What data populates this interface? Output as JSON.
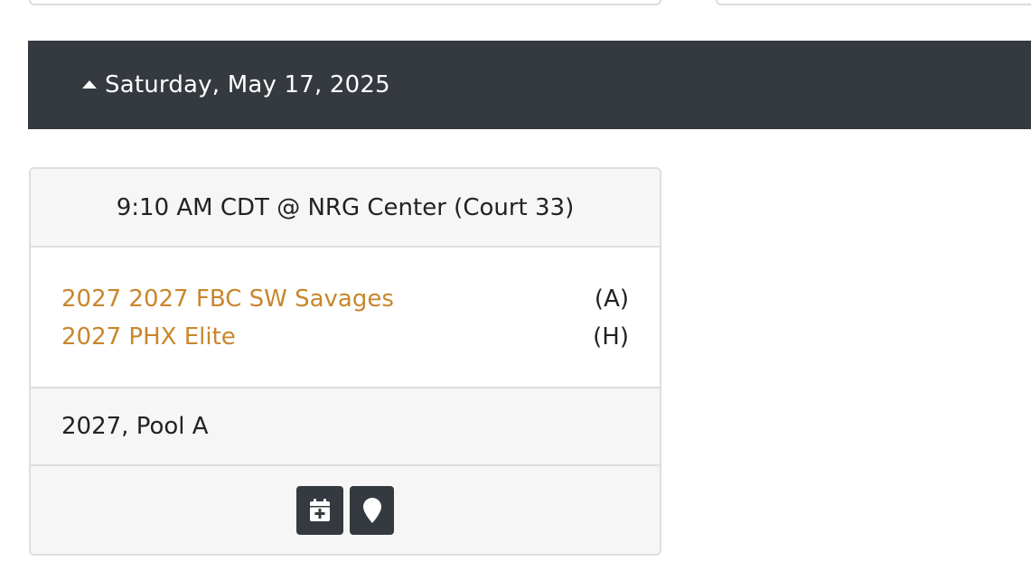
{
  "day_section": {
    "title": "Saturday, May 17, 2025"
  },
  "game": {
    "header": "9:10 AM CDT @ NRG Center (Court 33)",
    "teams": [
      {
        "name": "2027 2027 FBC SW Savages",
        "role": "(A)"
      },
      {
        "name": "2027 PHX Elite",
        "role": "(H)"
      }
    ],
    "pool": "2027, Pool A",
    "actions": [
      {
        "icon": "calendar-plus-icon"
      },
      {
        "icon": "map-marker-icon"
      }
    ]
  },
  "colors": {
    "header_bg": "#343a40",
    "team_link": "#c9862b",
    "card_muted_bg": "#f6f6f6"
  }
}
